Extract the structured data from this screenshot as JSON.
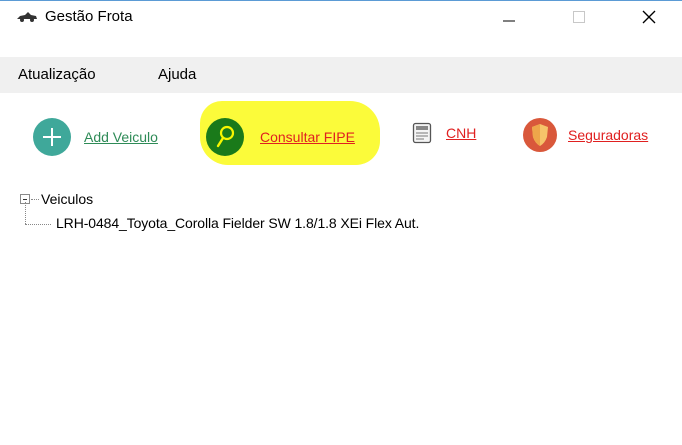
{
  "window": {
    "title": "Gestão Frota",
    "app_icon": "car-icon",
    "controls": {
      "minimize": "minimize-icon",
      "maximize": "maximize-icon",
      "close": "close-icon"
    }
  },
  "menu": {
    "items": [
      {
        "label": "Atualização"
      },
      {
        "label": "Ajuda"
      }
    ]
  },
  "toolbar": {
    "add_label": "Add Veiculo",
    "add_color": "#2e8b57",
    "fipe_label": "Consultar FIPE",
    "cnh_label": "CNH",
    "seguradoras_label": "Seguradoras",
    "link_red": "#e02020",
    "highlight_color": "#fbfb3a"
  },
  "tree": {
    "root_label": "Veiculos",
    "children": [
      {
        "label": "LRH-0484_Toyota_Corolla Fielder SW 1.8/1.8 XEi Flex Aut."
      }
    ]
  }
}
